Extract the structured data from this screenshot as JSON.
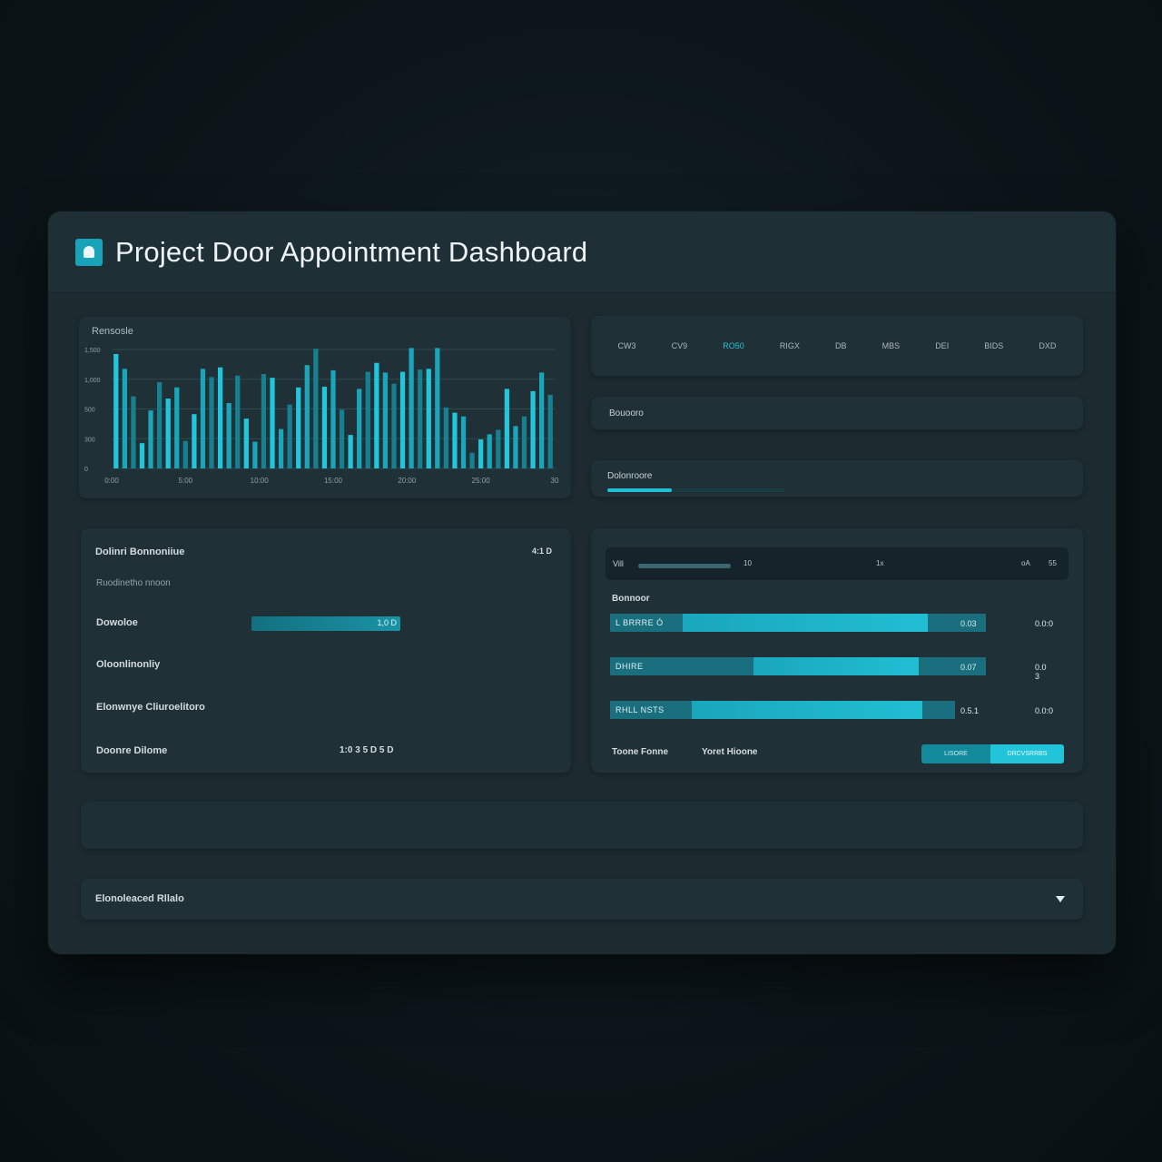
{
  "app": {
    "title": "Project Door Appointment Dashboard"
  },
  "chart": {
    "title": "Rensosle",
    "y_ticks": [
      "1,500",
      "1,000",
      "500",
      "300",
      "0"
    ],
    "x_ticks": [
      "0:00",
      "5:00",
      "10:00",
      "15:00",
      "20:00",
      "25:00",
      "30"
    ]
  },
  "chart_data": {
    "type": "bar",
    "title": "Rensosle",
    "xlabel": "",
    "ylabel": "",
    "ylim": [
      0,
      1600
    ],
    "grid": true,
    "series": [
      {
        "values": [
          1540,
          1340,
          970,
          340,
          780,
          1160,
          940,
          1090,
          370,
          730,
          1340,
          1230,
          1360,
          880,
          1250,
          670,
          360,
          1270,
          1220,
          530,
          860,
          1090,
          1390,
          1610,
          1100,
          1320,
          790,
          450,
          1070,
          1300,
          1420,
          1290,
          1140,
          1300,
          1620,
          1330,
          1340,
          1620,
          820,
          750,
          700,
          210,
          390,
          460,
          520,
          1070,
          570,
          700,
          1040,
          1290,
          990
        ]
      }
    ]
  },
  "tabs": {
    "items": [
      "CW3",
      "CV9",
      "RO50",
      "RIGX",
      "DB",
      "MBS",
      "DEI",
      "BIDS",
      "DXD"
    ],
    "active_index": 2
  },
  "filter": {
    "label": "Bouooro"
  },
  "progress": {
    "label": "Dolonroore",
    "value": 0.36
  },
  "details": {
    "title": "Dolinri Bonnoniiue",
    "title_value": "4:1 D",
    "subtitle": "Ruodinetho nnoon",
    "rows": [
      {
        "label": "Dowoloe",
        "bar_value": "1,0 D"
      },
      {
        "label": "Oloonlinonliy"
      },
      {
        "label": "Elonwnye Cliuroelitoro"
      },
      {
        "label": "Doonre Dilome",
        "value": "1:0 3 5 D 5 D"
      }
    ],
    "bar_fill": 1.0
  },
  "stats": {
    "search_label": "Vill",
    "search_ticks": [
      "10",
      "1x",
      "oA",
      "55"
    ],
    "section_label": "Bonnoor",
    "bars": [
      {
        "name": "L BRRRE Ó",
        "value": "0.03",
        "outer": "0.0:0",
        "fill": 0.65
      },
      {
        "name": "DHIRE",
        "value": "0.07",
        "outer": "0.0 3",
        "fill": 0.55
      },
      {
        "name": "RHLL NSTS",
        "value": "0.5.1",
        "outer": "0.0:0",
        "fill": 0.67
      }
    ],
    "footer_left": "Toone Fonne",
    "footer_mid": "Yoret Hioone",
    "button_a": "LISORE",
    "button_b": "DRCVSRRBS"
  },
  "accordion": {
    "label": "Elonoleaced Rllalo"
  },
  "colors": {
    "accent": "#22c0d6",
    "panel": "#1f3036",
    "background": "#0c1519"
  }
}
